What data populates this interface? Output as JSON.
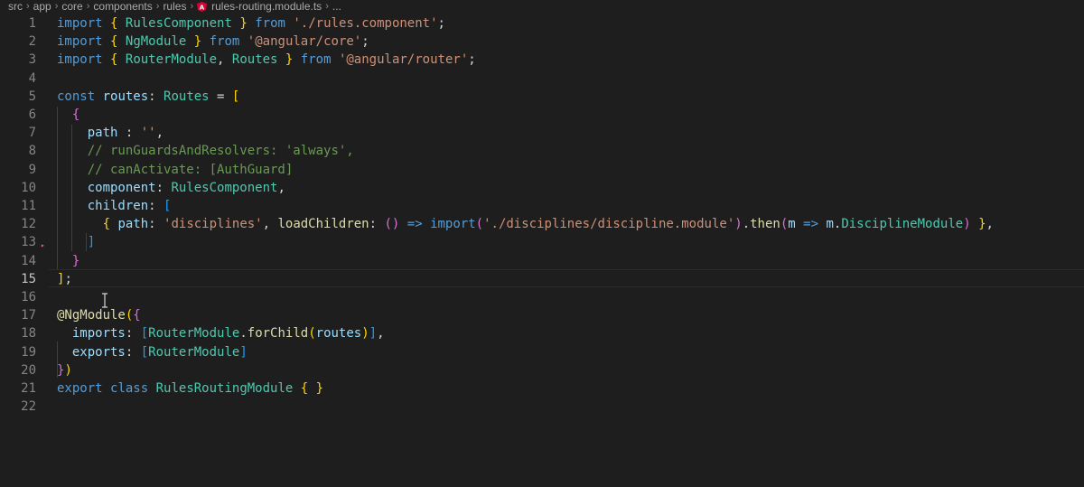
{
  "breadcrumb": {
    "items": [
      "src",
      "app",
      "core",
      "components",
      "rules"
    ],
    "file": "rules-routing.module.ts",
    "more": "..."
  },
  "editor": {
    "current_line": 15,
    "lines": [
      [
        [
          "kw",
          "import"
        ],
        [
          "punc",
          " "
        ],
        [
          "b1",
          "{"
        ],
        [
          "punc",
          " "
        ],
        [
          "cls",
          "RulesComponent"
        ],
        [
          "punc",
          " "
        ],
        [
          "b1",
          "}"
        ],
        [
          "punc",
          " "
        ],
        [
          "kw",
          "from"
        ],
        [
          "punc",
          " "
        ],
        [
          "str",
          "'./rules.component'"
        ],
        [
          "punc",
          ";"
        ]
      ],
      [
        [
          "kw",
          "import"
        ],
        [
          "punc",
          " "
        ],
        [
          "b1",
          "{"
        ],
        [
          "punc",
          " "
        ],
        [
          "cls",
          "NgModule"
        ],
        [
          "punc",
          " "
        ],
        [
          "b1",
          "}"
        ],
        [
          "punc",
          " "
        ],
        [
          "kw",
          "from"
        ],
        [
          "punc",
          " "
        ],
        [
          "str",
          "'@angular/core'"
        ],
        [
          "punc",
          ";"
        ]
      ],
      [
        [
          "kw",
          "import"
        ],
        [
          "punc",
          " "
        ],
        [
          "b1",
          "{"
        ],
        [
          "punc",
          " "
        ],
        [
          "cls",
          "RouterModule"
        ],
        [
          "punc",
          ", "
        ],
        [
          "cls",
          "Routes"
        ],
        [
          "punc",
          " "
        ],
        [
          "b1",
          "}"
        ],
        [
          "punc",
          " "
        ],
        [
          "kw",
          "from"
        ],
        [
          "punc",
          " "
        ],
        [
          "str",
          "'@angular/router'"
        ],
        [
          "punc",
          ";"
        ]
      ],
      [],
      [
        [
          "kw",
          "const"
        ],
        [
          "punc",
          " "
        ],
        [
          "var",
          "routes"
        ],
        [
          "punc",
          ": "
        ],
        [
          "cls",
          "Routes"
        ],
        [
          "punc",
          " = "
        ],
        [
          "b1",
          "["
        ]
      ],
      [
        [
          "punc",
          "  "
        ],
        [
          "b2",
          "{"
        ]
      ],
      [
        [
          "punc",
          "    "
        ],
        [
          "var",
          "path"
        ],
        [
          "punc",
          " : "
        ],
        [
          "str",
          "''"
        ],
        [
          "punc",
          ","
        ]
      ],
      [
        [
          "punc",
          "    "
        ],
        [
          "cmt",
          "// runGuardsAndResolvers: 'always',"
        ]
      ],
      [
        [
          "punc",
          "    "
        ],
        [
          "cmt",
          "// canActivate: [AuthGuard]"
        ]
      ],
      [
        [
          "punc",
          "    "
        ],
        [
          "var",
          "component"
        ],
        [
          "punc",
          ": "
        ],
        [
          "cls",
          "RulesComponent"
        ],
        [
          "punc",
          ","
        ]
      ],
      [
        [
          "punc",
          "    "
        ],
        [
          "var",
          "children"
        ],
        [
          "punc",
          ": "
        ],
        [
          "b3",
          "["
        ]
      ],
      [
        [
          "punc",
          "      "
        ],
        [
          "b1",
          "{"
        ],
        [
          "punc",
          " "
        ],
        [
          "var",
          "path"
        ],
        [
          "punc",
          ": "
        ],
        [
          "str",
          "'disciplines'"
        ],
        [
          "punc",
          ", "
        ],
        [
          "fn",
          "loadChildren"
        ],
        [
          "punc",
          ": "
        ],
        [
          "b2",
          "()"
        ],
        [
          "punc",
          " "
        ],
        [
          "kw",
          "=>"
        ],
        [
          "punc",
          " "
        ],
        [
          "kw",
          "import"
        ],
        [
          "b2",
          "("
        ],
        [
          "str",
          "'./disciplines/discipline.module'"
        ],
        [
          "b2",
          ")"
        ],
        [
          "punc",
          "."
        ],
        [
          "fn",
          "then"
        ],
        [
          "b2",
          "("
        ],
        [
          "var",
          "m"
        ],
        [
          "punc",
          " "
        ],
        [
          "kw",
          "=>"
        ],
        [
          "punc",
          " "
        ],
        [
          "var",
          "m"
        ],
        [
          "punc",
          "."
        ],
        [
          "cls",
          "DisciplineModule"
        ],
        [
          "b2",
          ")"
        ],
        [
          "punc",
          " "
        ],
        [
          "b1",
          "}"
        ],
        [
          "punc",
          ","
        ]
      ],
      [
        [
          "punc",
          "    "
        ],
        [
          "b3",
          "]"
        ]
      ],
      [
        [
          "punc",
          "  "
        ],
        [
          "b2",
          "}"
        ]
      ],
      [
        [
          "b1",
          "]"
        ],
        [
          "punc",
          ";"
        ]
      ],
      [],
      [
        [
          "fn",
          "@NgModule"
        ],
        [
          "b1",
          "("
        ],
        [
          "b2",
          "{"
        ]
      ],
      [
        [
          "punc",
          "  "
        ],
        [
          "var",
          "imports"
        ],
        [
          "punc",
          ": "
        ],
        [
          "b3",
          "["
        ],
        [
          "cls",
          "RouterModule"
        ],
        [
          "punc",
          "."
        ],
        [
          "fn",
          "forChild"
        ],
        [
          "b1",
          "("
        ],
        [
          "var",
          "routes"
        ],
        [
          "b1",
          ")"
        ],
        [
          "b3",
          "]"
        ],
        [
          "punc",
          ","
        ]
      ],
      [
        [
          "punc",
          "  "
        ],
        [
          "var",
          "exports"
        ],
        [
          "punc",
          ": "
        ],
        [
          "b3",
          "["
        ],
        [
          "cls",
          "RouterModule"
        ],
        [
          "b3",
          "]"
        ]
      ],
      [
        [
          "b2",
          "}"
        ],
        [
          "b1",
          ")"
        ]
      ],
      [
        [
          "kw",
          "export"
        ],
        [
          "punc",
          " "
        ],
        [
          "kw",
          "class"
        ],
        [
          "punc",
          " "
        ],
        [
          "cls",
          "RulesRoutingModule"
        ],
        [
          "punc",
          " "
        ],
        [
          "b1",
          "{"
        ],
        [
          "punc",
          " "
        ],
        [
          "b1",
          "}"
        ]
      ],
      []
    ]
  },
  "colors": {
    "background": "#1e1e1e",
    "keyword": "#569cd6",
    "type": "#4ec9b0",
    "variable": "#9cdcfe",
    "string": "#ce9178",
    "comment": "#6a9955",
    "function": "#dcdcaa"
  },
  "icons": {
    "file": "angular-icon",
    "cursor": "text-cursor-icon"
  }
}
